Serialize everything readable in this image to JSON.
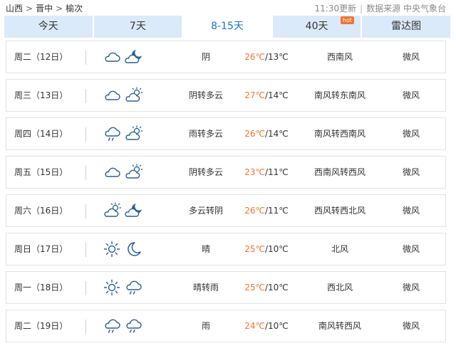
{
  "breadcrumb": {
    "province": "山西",
    "city": "晋中",
    "county": "榆次",
    "sep": ">"
  },
  "meta": {
    "updated": "11:30更新",
    "sep": "|",
    "source": "数据来源 中央气象台"
  },
  "tabs": [
    {
      "label": "今天"
    },
    {
      "label": "7天"
    },
    {
      "label": "8-15天",
      "active": true
    },
    {
      "label": "40天",
      "badge": "hot"
    },
    {
      "label": "雷达图"
    }
  ],
  "days": [
    {
      "day": "周二（12日）",
      "icon1": "cloud-icon",
      "icon2": "cloudy-night-icon",
      "cond": "阴",
      "high": "26℃",
      "low": "/13℃",
      "wind": "西南风",
      "force": "微风"
    },
    {
      "day": "周三（13日）",
      "icon1": "cloud-icon",
      "icon2": "partly-cloudy-icon",
      "cond": "阴转多云",
      "high": "27℃",
      "low": "/14℃",
      "wind": "南风转东南风",
      "force": "微风"
    },
    {
      "day": "周四（14日）",
      "icon1": "rain-icon",
      "icon2": "partly-cloudy-icon",
      "cond": "雨转多云",
      "high": "26℃",
      "low": "/14℃",
      "wind": "南风转西南风",
      "force": "微风"
    },
    {
      "day": "周五（15日）",
      "icon1": "cloud-icon",
      "icon2": "partly-cloudy-icon",
      "cond": "阴转多云",
      "high": "23℃",
      "low": "/11℃",
      "wind": "西南风转西风",
      "force": "微风"
    },
    {
      "day": "周六（16日）",
      "icon1": "partly-cloudy-icon",
      "icon2": "cloudy-night-icon",
      "cond": "多云转阴",
      "high": "26℃",
      "low": "/11℃",
      "wind": "西风转西北风",
      "force": "微风"
    },
    {
      "day": "周日（17日）",
      "icon1": "sun-icon",
      "icon2": "moon-icon",
      "cond": "晴",
      "high": "25℃",
      "low": "/10℃",
      "wind": "北风",
      "force": "微风"
    },
    {
      "day": "周一（18日）",
      "icon1": "sun-icon",
      "icon2": "rain-icon",
      "cond": "晴转雨",
      "high": "25℃",
      "low": "/10℃",
      "wind": "西北风",
      "force": "微风"
    },
    {
      "day": "周二（19日）",
      "icon1": "rain-icon",
      "icon2": "rain-icon",
      "cond": "雨",
      "high": "24℃",
      "low": "/10℃",
      "wind": "南风转西风",
      "force": "微风"
    }
  ],
  "colors": {
    "accent": "#1e73c8",
    "tab_bg": "#dbeafa",
    "high_temp": "#f07431",
    "icon_stroke": "#2b5f93"
  }
}
